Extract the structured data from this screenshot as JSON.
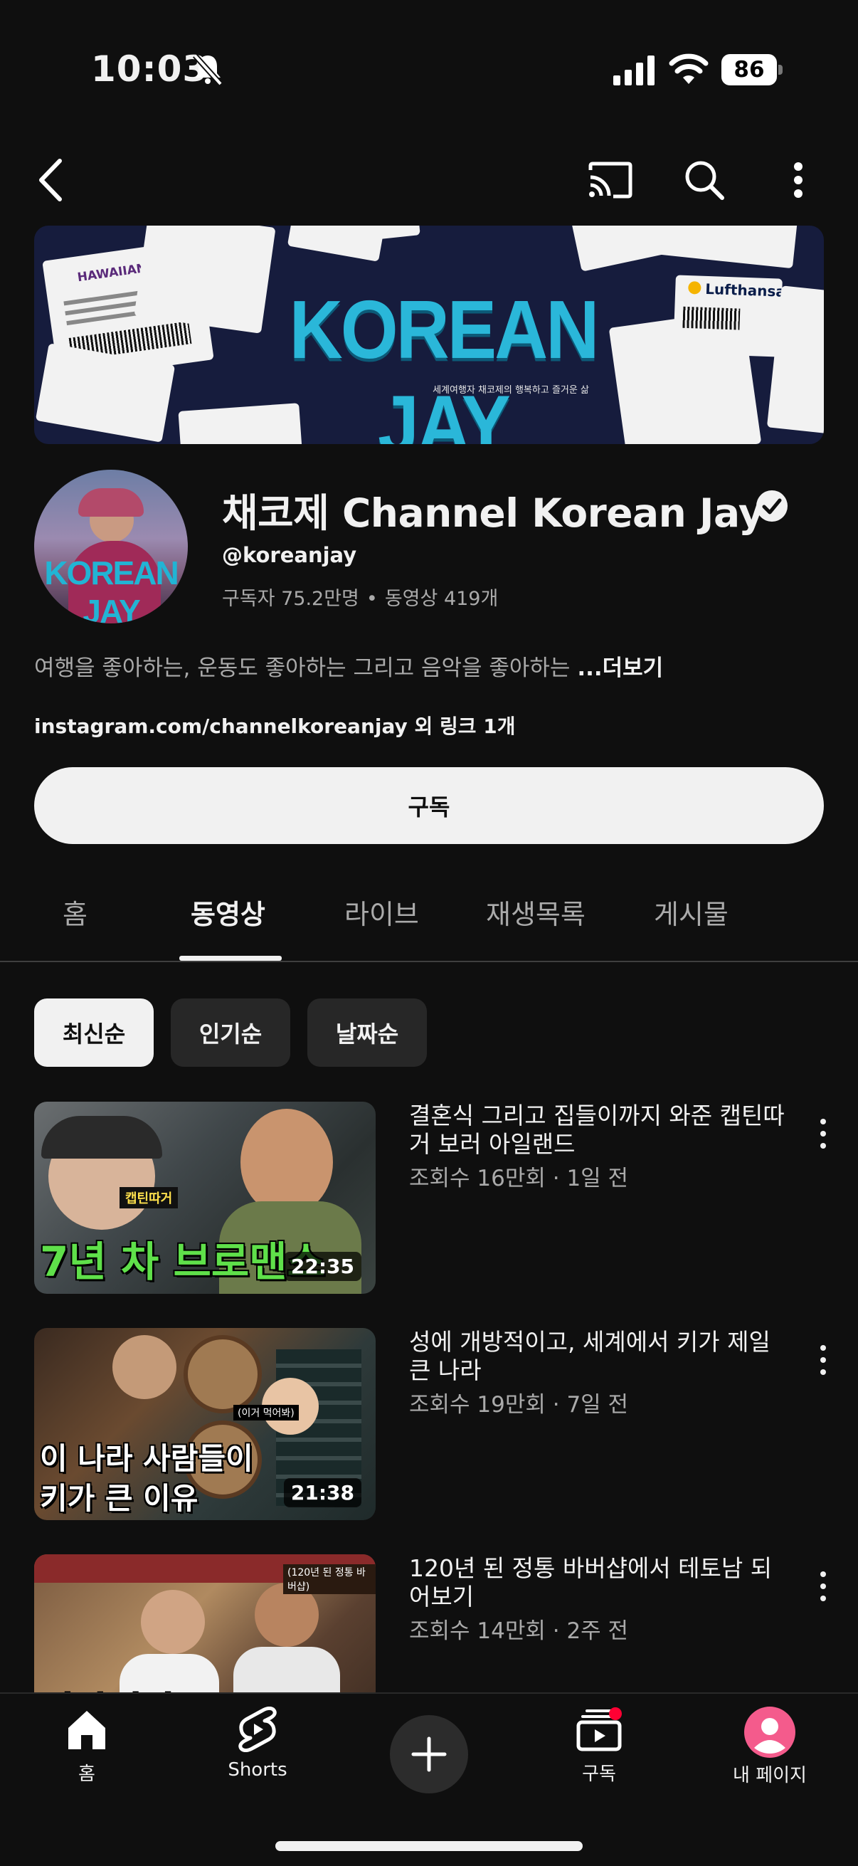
{
  "status": {
    "time": "10:03",
    "battery": "86"
  },
  "banner": {
    "title": "KOREAN JAY",
    "subtitle": "세계여행자 채코제의 행복하고 즐거운 삶",
    "ticket_airline_1": "HAWAIIAN",
    "ticket_airline_2": "Lufthansa"
  },
  "channel": {
    "name": "채코제 Channel Korean Jay",
    "handle": "@koreanjay",
    "subscribers": "구독자 75.2만명",
    "separator": "•",
    "videos": "동영상 419개",
    "description": "여행을 좋아하는, 운동도 좋아하는 그리고 음악을 좋아하는 ",
    "more": "...더보기",
    "links": "instagram.com/channelkoreanjay 외 링크 1개",
    "avatar_text": "KOREAN JAY",
    "subscribe_label": "구독"
  },
  "tabs": [
    {
      "label": "홈"
    },
    {
      "label": "동영상"
    },
    {
      "label": "라이브"
    },
    {
      "label": "재생목록"
    },
    {
      "label": "게시물"
    }
  ],
  "chips": [
    {
      "label": "최신순"
    },
    {
      "label": "인기순"
    },
    {
      "label": "날짜순"
    }
  ],
  "videos": [
    {
      "title": "결혼식 그리고 집들이까지 와준 캡틴따거 보러 아일랜드",
      "meta": "조회수 16만회 · 1일 전",
      "duration": "22:35",
      "thumb_caption": "7년 차 브로맨스",
      "thumb_tag": "캡틴따거"
    },
    {
      "title": "성에 개방적이고, 세계에서 키가 제일 큰 나라",
      "meta": "조회수 19만회 · 7일 전",
      "duration": "21:38",
      "thumb_caption_1": "이 나라 사람들이",
      "thumb_caption_2": "키가 큰 이유",
      "thumb_tag": "(이거 먹어봐)"
    },
    {
      "title": "120년 된 정통 바버샵에서 테토남 되어보기",
      "meta": "조회수 14만회 · 2주 전",
      "thumb_caption": "이탈리아",
      "thumb_tag": "(120년 된 정통 바버샵)"
    }
  ],
  "bottom_nav": [
    {
      "label": "홈"
    },
    {
      "label": "Shorts"
    },
    {
      "label": "구독"
    },
    {
      "label": "내 페이지"
    }
  ],
  "colors": {
    "background": "#0f0f0f",
    "chip": "#272727",
    "secondary_text": "#aaaaaa",
    "notification_dot": "#ff0033",
    "avatar_pink": "#f45b8c"
  }
}
